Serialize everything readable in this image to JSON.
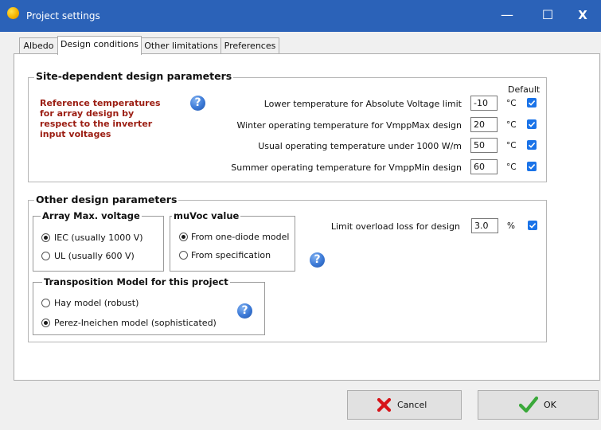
{
  "window": {
    "title": "Project settings",
    "minimize": "—",
    "maximize": "☐",
    "close": "X"
  },
  "tabs": [
    "Albedo",
    "Design conditions",
    "Other limitations",
    "Preferences"
  ],
  "site": {
    "title": "Site-dependent design parameters",
    "default_header": "Default",
    "reference_text": [
      "Reference temperatures",
      "for array design by",
      "respect to the inverter",
      "input voltages"
    ],
    "rows": [
      {
        "label": "Lower temperature for Absolute Voltage limit",
        "value": "-10",
        "unit": "°C",
        "default": true
      },
      {
        "label": "Winter operating temperature for VmppMax design",
        "value": "20",
        "unit": "°C",
        "default": true
      },
      {
        "label": "Usual operating temperature under 1000 W/m",
        "value": "50",
        "unit": "°C",
        "default": true
      },
      {
        "label": "Summer operating temperature for VmppMin design",
        "value": "60",
        "unit": "°C",
        "default": true
      }
    ]
  },
  "other": {
    "title": "Other design parameters",
    "array_max_voltage": {
      "title": "Array Max. voltage",
      "options": [
        "IEC (usually 1000 V)",
        "UL (usually 600 V)"
      ],
      "selected": 0
    },
    "muvoc": {
      "title": "muVoc value",
      "options": [
        "From one-diode model",
        "From specification"
      ],
      "selected": 0
    },
    "transposition": {
      "title": "Transposition Model for this project",
      "options": [
        "Hay model (robust)",
        "Perez-Ineichen model (sophisticated)"
      ],
      "selected": 1
    },
    "overload": {
      "label": "Limit overload loss for design",
      "value": "3.0",
      "unit": "%",
      "checked": true
    }
  },
  "buttons": {
    "cancel": "Cancel",
    "ok": "OK"
  },
  "colors": {
    "titlebar": "#2b62b8",
    "accent": "#1a73e8",
    "reference_text": "#9b1d12"
  }
}
